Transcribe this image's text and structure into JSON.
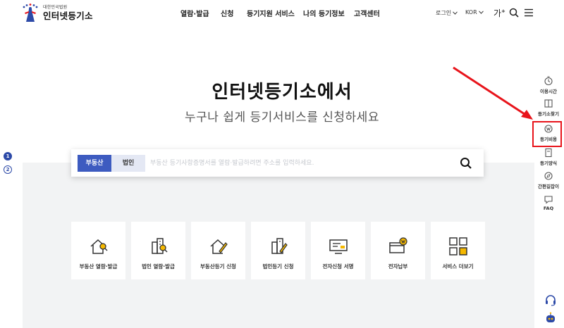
{
  "logo": {
    "org": "대한민국법원",
    "name": "인터넷등기소"
  },
  "nav": [
    "열람·발급",
    "신청",
    "등기지원 서비스",
    "나의 등기정보",
    "고객센터"
  ],
  "util": {
    "login": "로그인",
    "language": "KOR",
    "font_size": "가"
  },
  "hero": {
    "title": "인터넷등기소에서",
    "subtitle": "누구나 쉽게 등기서비스를 신청하세요"
  },
  "slider_bullets": [
    "1",
    "2"
  ],
  "search": {
    "tab_real_estate": "부동산",
    "tab_corporation": "법인",
    "placeholder": "부동산 등기사항증명서를 열람·발급하려면 주소를 입력하세요."
  },
  "services": [
    "부동산 열람·발급",
    "법인 열람·발급",
    "부동산등기 신청",
    "법인등기 신청",
    "전자신청 서명",
    "전자납부",
    "서비스 더보기"
  ],
  "quick_menu": [
    "이용시간",
    "등기소찾기",
    "등기비용",
    "등기양식",
    "간편길잡이",
    "FAQ"
  ],
  "colors": {
    "accent": "#3d5bc0",
    "tab_inactive": "#e4e8f4",
    "panel_bg": "#f2f3f4",
    "highlight": "#e8141b",
    "card_icon_accent": "#f5b800"
  }
}
